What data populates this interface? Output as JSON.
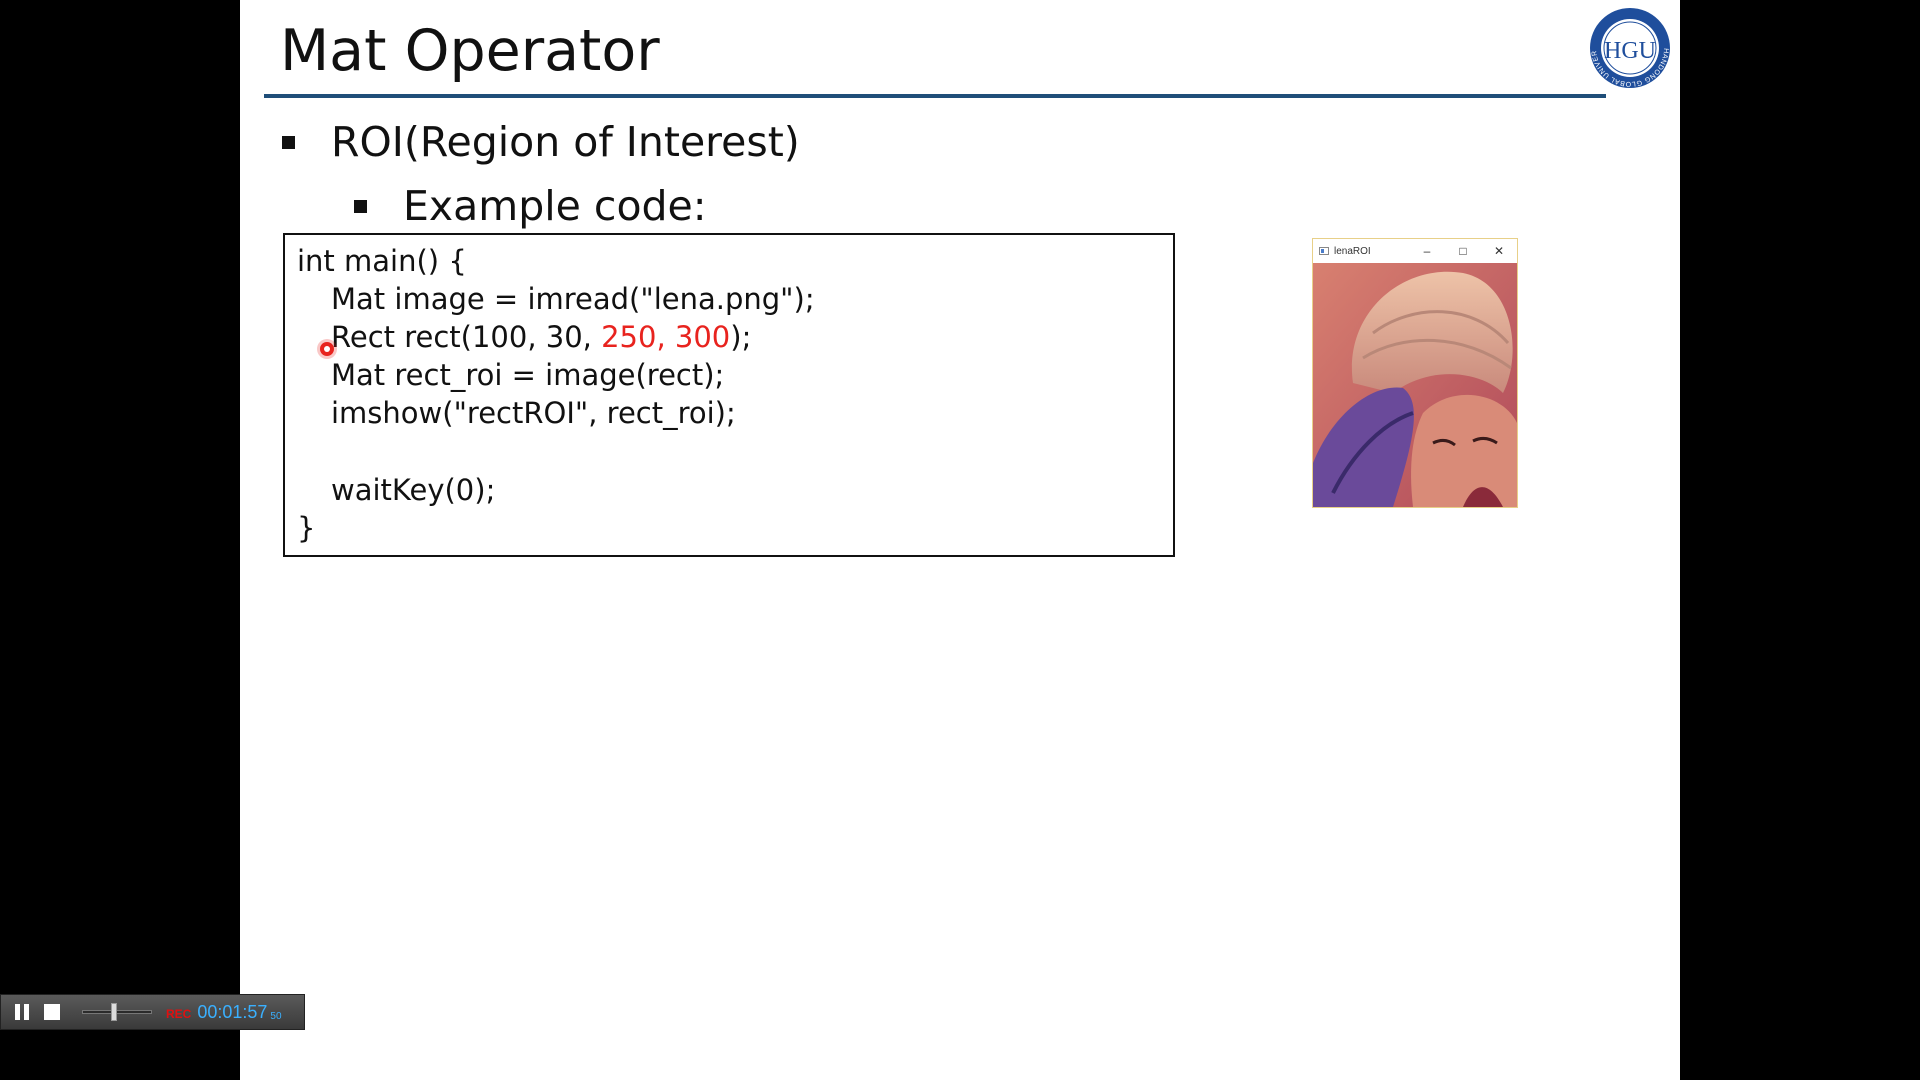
{
  "slide": {
    "title": "Mat Operator",
    "bullet_1": "ROI(Region of Interest)",
    "bullet_2": "Example code:",
    "title_rule_color": "#1f4e79"
  },
  "logo": {
    "icon": "university-seal-icon",
    "monogram": "HGU",
    "ring_text": "HANDONG GLOBAL UNIVERSITY",
    "color": "#1f4e9c"
  },
  "code": {
    "lines": [
      "int main() {",
      "Mat image = imread(\"lena.png\");",
      "Rect rect(100, 30, ",
      "Mat rect_roi = image(rect);",
      "imshow(\"rectROI\", rect_roi);",
      "",
      "waitKey(0);",
      "}"
    ],
    "line_3_highlight": "250, 300",
    "line_3_tail": ");",
    "highlight_color": "#e8231e"
  },
  "image_window": {
    "title": "lenaROI",
    "minimize_icon": "minimize-icon",
    "maximize_icon": "maximize-icon",
    "close_icon": "close-icon",
    "minimize_glyph": "–",
    "maximize_glyph": "□",
    "close_glyph": "✕"
  },
  "recorder": {
    "rec_label": "REC",
    "time": "00:01:57",
    "fraction": "50",
    "slider_position": 0.45,
    "time_color": "#3ab0ff",
    "rec_color": "#e01010"
  }
}
